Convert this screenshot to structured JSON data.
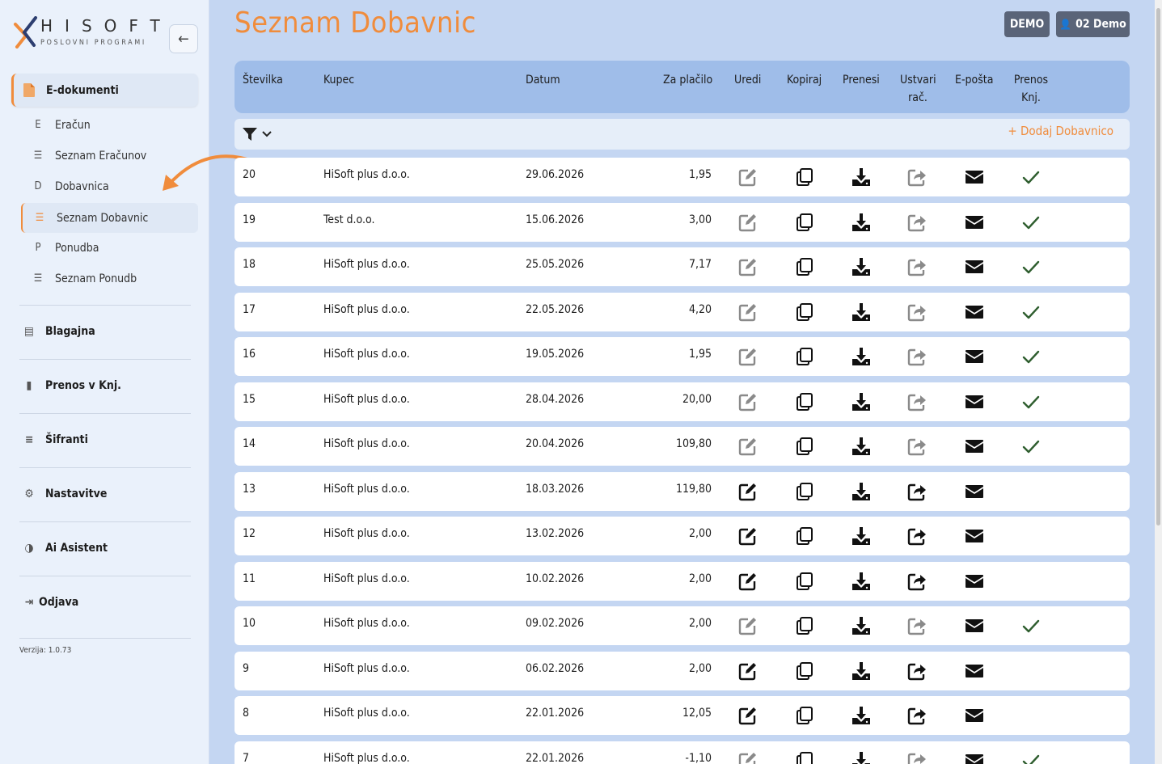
{
  "brand": {
    "name": "HISOFT",
    "tagline": "POSLOVNI PROGRAMI"
  },
  "sidebar": {
    "group_active": {
      "label": "E-dokumenti",
      "icon": "file-icon"
    },
    "sub_items": [
      {
        "label": "Eračun",
        "icon_char": "E"
      },
      {
        "label": "Seznam Eračunov",
        "icon_char": "☰"
      },
      {
        "label": "Dobavnica",
        "icon_char": "D"
      },
      {
        "label": "Seznam Dobavnic",
        "icon_char": "☰",
        "active": true
      },
      {
        "label": "Ponudba",
        "icon_char": "P"
      },
      {
        "label": "Seznam Ponudb",
        "icon_char": "☰"
      }
    ],
    "groups": [
      {
        "label": "Blagajna",
        "icon": "cash-register-icon"
      },
      {
        "label": "Prenos v Knj.",
        "icon": "book-icon"
      },
      {
        "label": "Šifranti",
        "icon": "database-icon"
      },
      {
        "label": "Nastavitve",
        "icon": "gear-icon"
      },
      {
        "label": "Ai Asistent",
        "icon": "brain-icon"
      },
      {
        "label": "Odjava",
        "icon": "logout-icon"
      }
    ],
    "version": "Verzija: 1.0.73"
  },
  "header": {
    "title": "Seznam Dobavnic",
    "demo_label": "DEMO",
    "user_label": "02 Demo"
  },
  "table": {
    "columns": {
      "stevilka": "Številka",
      "kupec": "Kupec",
      "datum": "Datum",
      "za_placilo": "Za plačilo",
      "uredi": "Uredi",
      "kopiraj": "Kopiraj",
      "prenesi": "Prenesi",
      "ustvari_1": "Ustvari",
      "ustvari_2": "rač.",
      "eposta": "E-pošta",
      "prenos_1": "Prenos",
      "prenos_2": "Knj."
    },
    "add_label": "Dodaj Dobavnico",
    "rows": [
      {
        "st": "20",
        "kupec": "HiSoft plus d.o.o.",
        "datum": "29.06.2026",
        "znesek": "1,95",
        "prenos": true
      },
      {
        "st": "19",
        "kupec": "Test d.o.o.",
        "datum": "15.06.2026",
        "znesek": "3,00",
        "prenos": true
      },
      {
        "st": "18",
        "kupec": "HiSoft plus d.o.o.",
        "datum": "25.05.2026",
        "znesek": "7,17",
        "prenos": true
      },
      {
        "st": "17",
        "kupec": "HiSoft plus d.o.o.",
        "datum": "22.05.2026",
        "znesek": "4,20",
        "prenos": true
      },
      {
        "st": "16",
        "kupec": "HiSoft plus d.o.o.",
        "datum": "19.05.2026",
        "znesek": "1,95",
        "prenos": true
      },
      {
        "st": "15",
        "kupec": "HiSoft plus d.o.o.",
        "datum": "28.04.2026",
        "znesek": "20,00",
        "prenos": true
      },
      {
        "st": "14",
        "kupec": "HiSoft plus d.o.o.",
        "datum": "20.04.2026",
        "znesek": "109,80",
        "prenos": true
      },
      {
        "st": "13",
        "kupec": "HiSoft plus d.o.o.",
        "datum": "18.03.2026",
        "znesek": "119,80",
        "prenos": false
      },
      {
        "st": "12",
        "kupec": "HiSoft plus d.o.o.",
        "datum": "13.02.2026",
        "znesek": "2,00",
        "prenos": false
      },
      {
        "st": "11",
        "kupec": "HiSoft plus d.o.o.",
        "datum": "10.02.2026",
        "znesek": "2,00",
        "prenos": false
      },
      {
        "st": "10",
        "kupec": "HiSoft plus d.o.o.",
        "datum": "09.02.2026",
        "znesek": "2,00",
        "prenos": true
      },
      {
        "st": "9",
        "kupec": "HiSoft plus d.o.o.",
        "datum": "06.02.2026",
        "znesek": "2,00",
        "prenos": false
      },
      {
        "st": "8",
        "kupec": "HiSoft plus d.o.o.",
        "datum": "22.01.2026",
        "znesek": "12,05",
        "prenos": false
      },
      {
        "st": "7",
        "kupec": "HiSoft plus d.o.o.",
        "datum": "22.01.2026",
        "znesek": "-1,10",
        "prenos": true
      }
    ]
  },
  "colors": {
    "accent": "#f08c3c",
    "header_bg": "#9fbde9",
    "button_bg": "#5a6478"
  }
}
